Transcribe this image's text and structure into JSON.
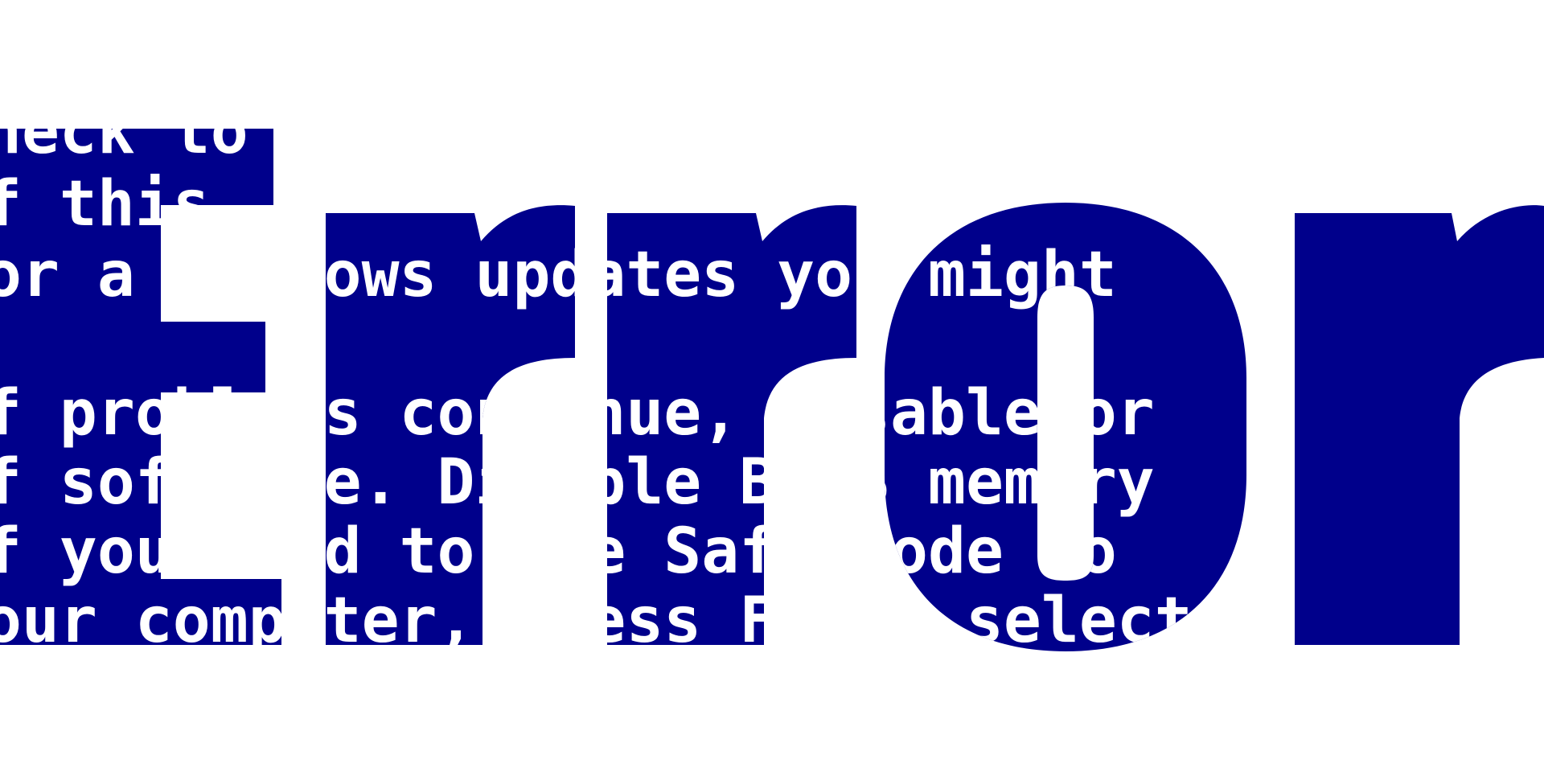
{
  "artwork": {
    "word": "Error",
    "background_color": "#ffffff",
    "panel_color": "#00008b",
    "text_color": "#ffffff",
    "bsod_lines": [
      "heck to",
      "f this",
      "or a windows updates you might",
      "",
      "f problems continue, disable or",
      "f software. Disable BIOS memory",
      "f you need to use Safe Mode to",
      "our computer, press F8 to select"
    ]
  }
}
